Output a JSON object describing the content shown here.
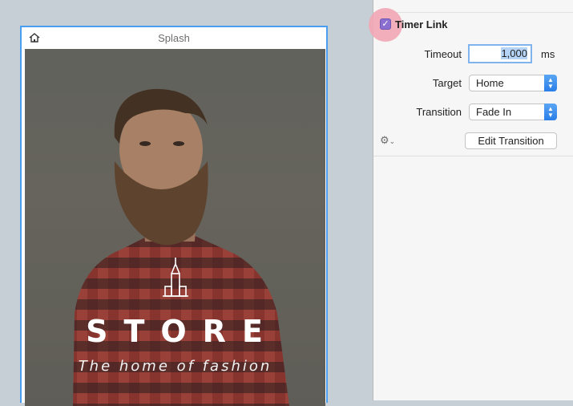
{
  "artboard": {
    "title": "Splash",
    "brand_title": "STORE",
    "brand_tagline": "The home of fashion"
  },
  "inspector": {
    "timer_link_label": "Timer Link",
    "timer_link_checked": true,
    "timeout_label": "Timeout",
    "timeout_value": "1,000",
    "timeout_unit": "ms",
    "target_label": "Target",
    "target_value": "Home",
    "transition_label": "Transition",
    "transition_value": "Fade In",
    "edit_transition_label": "Edit Transition"
  },
  "colors": {
    "canvas": "#c6ced6",
    "selection_border": "#4a9ef2",
    "checkbox": "#8a6fd0",
    "highlight": "#f2a6b4",
    "select_accent": "#2a7ee8"
  },
  "icons": [
    "home-icon",
    "store-building-icon",
    "gear-icon",
    "chevron-down-icon",
    "select-arrows-icon",
    "checkmark-icon"
  ]
}
